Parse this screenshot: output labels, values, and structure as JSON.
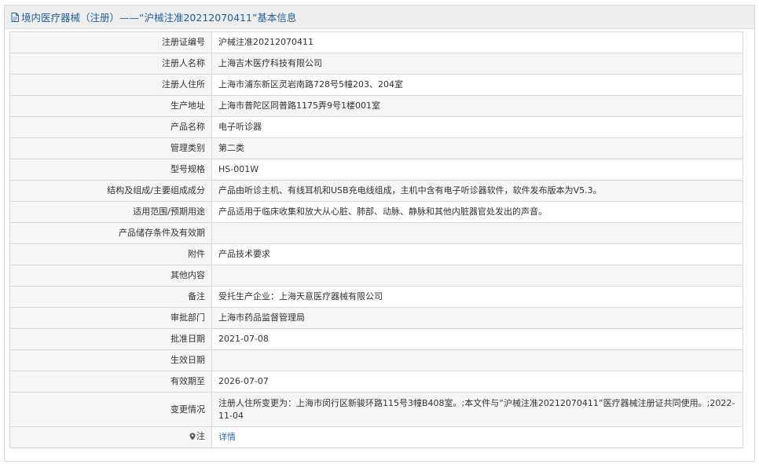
{
  "header": {
    "title": "境内医疗器械（注册）——“沪械注准20212070411”基本信息",
    "icon": "document-icon"
  },
  "colors": {
    "header_text": "#1f5f9a",
    "link": "#2b6cb0",
    "border": "#d9d9d9"
  },
  "rows": [
    {
      "label": "注册证编号",
      "value": "沪械注准20212070411"
    },
    {
      "label": "注册人名称",
      "value": "上海吉木医疗科技有限公司"
    },
    {
      "label": "注册人住所",
      "value": "上海市浦东新区灵岩南路728号5幢203、204室"
    },
    {
      "label": "生产地址",
      "value": "上海市普陀区同普路1175弄9号1楼001室"
    },
    {
      "label": "产品名称",
      "value": "电子听诊器"
    },
    {
      "label": "管理类别",
      "value": "第二类"
    },
    {
      "label": "型号规格",
      "value": "HS-001W"
    },
    {
      "label": "结构及组成/主要组成成分",
      "value": "产品由听诊主机、有线耳机和USB充电线组成，主机中含有电子听诊器软件，软件发布版本为V5.3。"
    },
    {
      "label": "适用范围/预期用途",
      "value": "产品适用于临床收集和放大从心脏、肺部、动脉、静脉和其他内脏器官处发出的声音。"
    },
    {
      "label": "产品储存条件及有效期",
      "value": ""
    },
    {
      "label": "附件",
      "value": "产品技术要求"
    },
    {
      "label": "其他内容",
      "value": ""
    },
    {
      "label": "备注",
      "value": "受托生产企业：上海天意医疗器械有限公司"
    },
    {
      "label": "审批部门",
      "value": "上海市药品监督管理局"
    },
    {
      "label": "批准日期",
      "value": "2021-07-08"
    },
    {
      "label": "生效日期",
      "value": ""
    },
    {
      "label": "有效期至",
      "value": "2026-07-07"
    },
    {
      "label": "变更情况",
      "value": "注册人住所变更为：上海市闵行区新骏环路115号3幢B408室。;本文件与“沪械注准20212070411”医疗器械注册证共同使用。;2022-11-04"
    }
  ],
  "note": {
    "label": "注",
    "icon": "location-pin-icon",
    "link_text": "详情"
  }
}
